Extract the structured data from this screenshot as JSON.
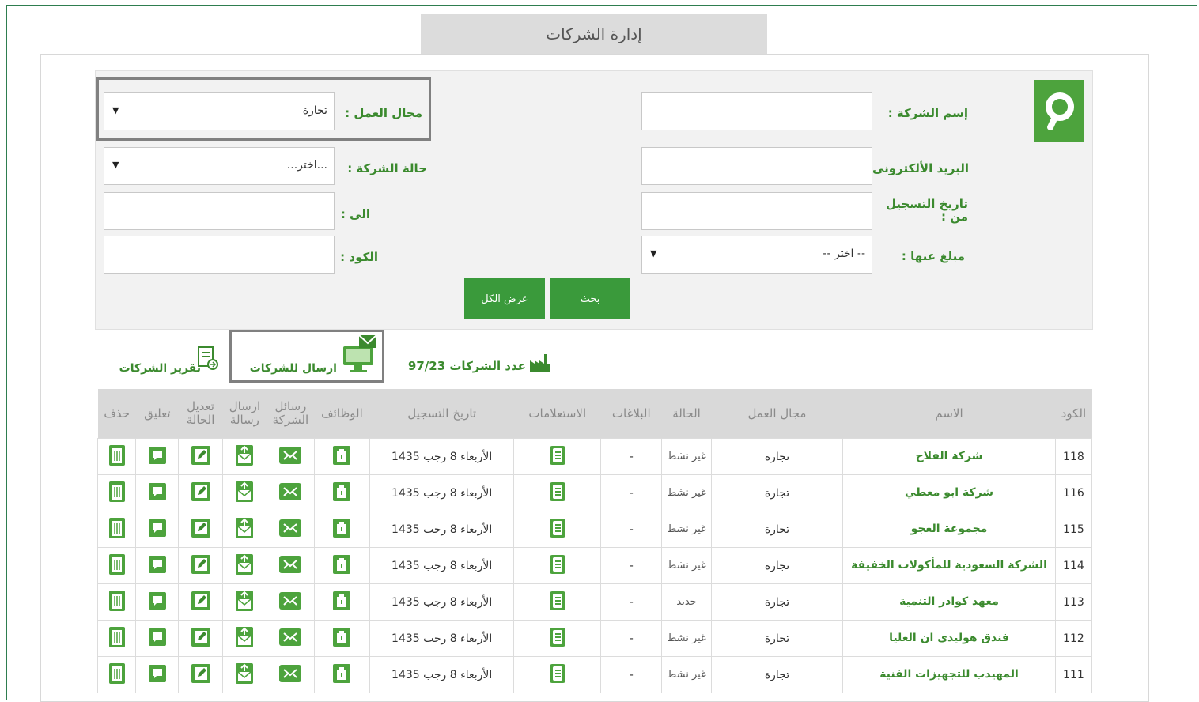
{
  "page": {
    "title": "إدارة الشركات"
  },
  "search": {
    "company_name_label": "إسم الشركة :",
    "work_field_label": "مجال العمل :",
    "work_field_value": "تجارة",
    "email_label": "البريد الألكترونى :",
    "company_status_label": "حالة الشركة :",
    "company_status_value": "...اختر...",
    "reg_date_from_label": "تاريخ التسجيل من :",
    "to_label": "الى :",
    "reported_amount_label": "مبلغ عنها :",
    "reported_amount_value": "-- اختر --",
    "code_label": "الكود :",
    "search_button": "بحث",
    "show_all_button": "عرض الكل"
  },
  "toolbar": {
    "count_text": "عدد الشركات 97/23",
    "send_to_companies": "ارسال للشركات",
    "companies_report": "تقرير الشركات"
  },
  "table": {
    "headers": {
      "code": "الكود",
      "name": "الاسم",
      "field": "مجال العمل",
      "status": "الحالة",
      "reports": "البلاغات",
      "inquiries": "الاستعلامات",
      "reg_date": "تاريخ التسجيل",
      "jobs": "الوظائف",
      "company_messages": "رسائل الشركة",
      "send_message": "ارسال رسالة",
      "edit_status": "تعديل الحالة",
      "comment": "تعليق",
      "delete": "حذف"
    },
    "rows": [
      {
        "code": "118",
        "name": "شركة الفلاح",
        "field": "تجارة",
        "status": "غير نشط",
        "reports": "-",
        "reg_date": "الأربعاء 8 رجب 1435"
      },
      {
        "code": "116",
        "name": "شركة ابو معطي",
        "field": "تجارة",
        "status": "غير نشط",
        "reports": "-",
        "reg_date": "الأربعاء 8 رجب 1435"
      },
      {
        "code": "115",
        "name": "مجموعة العجو",
        "field": "تجارة",
        "status": "غير نشط",
        "reports": "-",
        "reg_date": "الأربعاء 8 رجب 1435"
      },
      {
        "code": "114",
        "name": "الشركة السعودية للمأكولات الخفيفة",
        "field": "تجارة",
        "status": "غير نشط",
        "reports": "-",
        "reg_date": "الأربعاء 8 رجب 1435"
      },
      {
        "code": "113",
        "name": "معهد كوادر التنمية",
        "field": "تجارة",
        "status": "جديد",
        "reports": "-",
        "reg_date": "الأربعاء 8 رجب 1435"
      },
      {
        "code": "112",
        "name": "فندق هوليدى ان العليا",
        "field": "تجارة",
        "status": "غير نشط",
        "reports": "-",
        "reg_date": "الأربعاء 8 رجب 1435"
      },
      {
        "code": "111",
        "name": "المهيدب للتجهيزات الفنية",
        "field": "تجارة",
        "status": "غير نشط",
        "reports": "-",
        "reg_date": "الأربعاء 8 رجب 1435"
      }
    ]
  },
  "colors": {
    "accent": "#3b8a2e",
    "button": "#3a9a3b",
    "header_bg": "#d9d9d9"
  }
}
